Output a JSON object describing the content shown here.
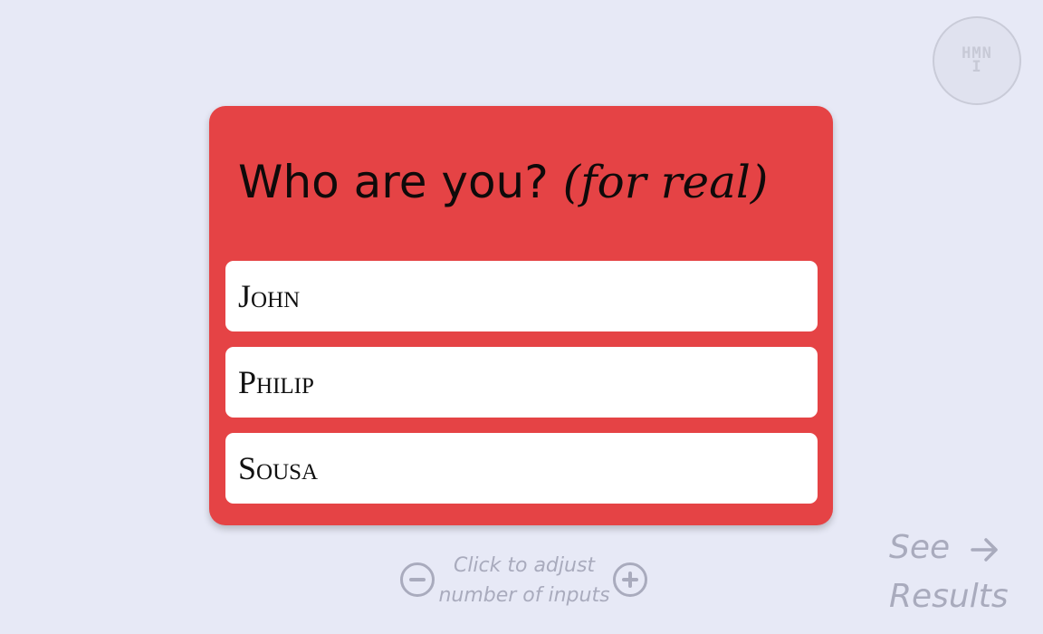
{
  "logo": {
    "text": "HMNI"
  },
  "card": {
    "title_main": "Who are you? ",
    "title_emphasis": "(for real)",
    "inputs": [
      {
        "value": "John",
        "placeholder": ""
      },
      {
        "value": "Philip",
        "placeholder": ""
      },
      {
        "value": "Sousa",
        "placeholder": ""
      }
    ],
    "background_color": "#e54345"
  },
  "controls": {
    "adjust_hint_line1": "Click to adjust",
    "adjust_hint_line2": "number of inputs",
    "decrease_icon": "minus-circle-icon",
    "increase_icon": "plus-circle-icon"
  },
  "results_link": {
    "line1": "See",
    "line2": "Results",
    "icon": "arrow-right-icon"
  },
  "colors": {
    "page_background": "#e7e9f6",
    "muted_text": "#a9abbd"
  }
}
